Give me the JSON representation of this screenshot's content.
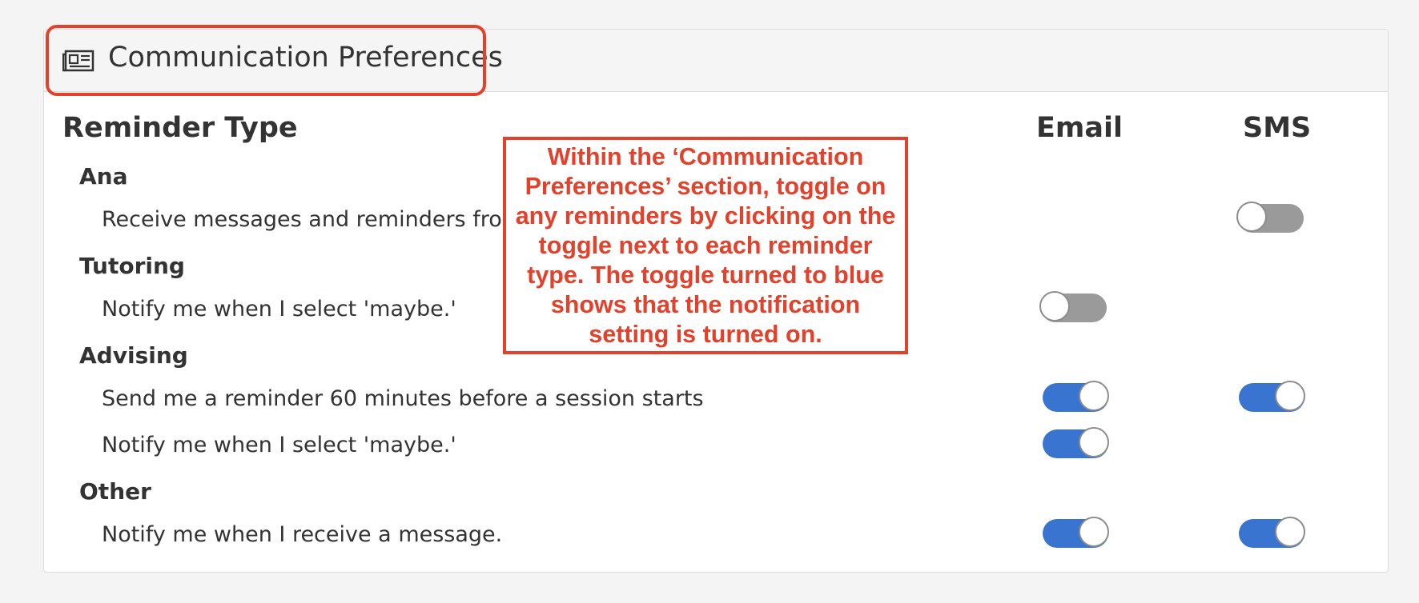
{
  "header": {
    "icon": "newspaper-icon",
    "title": "Communication Preferences"
  },
  "columns": {
    "reminder_type": "Reminder Type",
    "email": "Email",
    "sms": "SMS"
  },
  "groups": [
    {
      "name": "Ana",
      "items": [
        {
          "label": "Receive messages and reminders from",
          "email": null,
          "sms": false
        }
      ]
    },
    {
      "name": "Tutoring",
      "items": [
        {
          "label": "Notify me when I select 'maybe.'",
          "email": false,
          "sms": null
        }
      ]
    },
    {
      "name": "Advising",
      "items": [
        {
          "label": "Send me a reminder 60 minutes before a session starts",
          "email": true,
          "sms": true
        },
        {
          "label": "Notify me when I select 'maybe.'",
          "email": true,
          "sms": null
        }
      ]
    },
    {
      "name": "Other",
      "items": [
        {
          "label": "Notify me when I receive a message.",
          "email": true,
          "sms": true
        }
      ]
    }
  ],
  "callout": {
    "text": "Within the ‘Communication Preferences’ section, toggle on any reminders by clicking on the toggle next to each reminder type. The toggle turned to blue shows that the notification setting is turned on."
  },
  "colors": {
    "toggle_on": "#3874d0",
    "toggle_off": "#9a9a9a",
    "annotation": "#e2412c"
  }
}
